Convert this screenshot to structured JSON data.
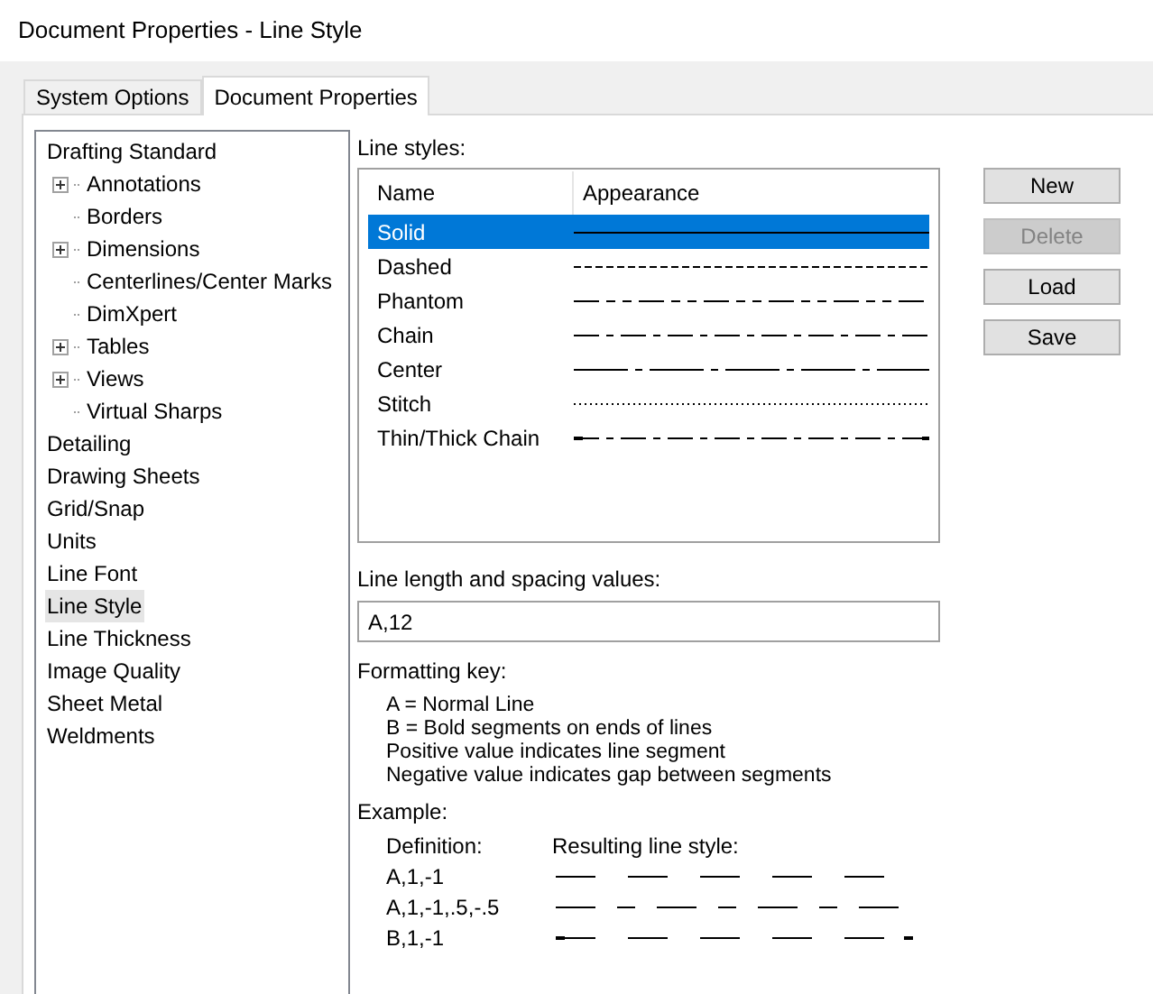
{
  "window": {
    "title": "Document Properties - Line Style"
  },
  "tabs": [
    {
      "label": "System Options",
      "selected": false
    },
    {
      "label": "Document Properties",
      "selected": true
    }
  ],
  "tree": [
    {
      "label": "Drafting Standard",
      "selected": false,
      "children": [
        {
          "label": "Annotations",
          "kind": "collapsed",
          "selected": false
        },
        {
          "label": "Borders",
          "kind": "leaf",
          "selected": false
        },
        {
          "label": "Dimensions",
          "kind": "collapsed",
          "selected": false
        },
        {
          "label": "Centerlines/Center Marks",
          "kind": "leaf",
          "selected": false
        },
        {
          "label": "DimXpert",
          "kind": "leaf",
          "selected": false
        },
        {
          "label": "Tables",
          "kind": "collapsed",
          "selected": false
        },
        {
          "label": "Views",
          "kind": "collapsed",
          "selected": false
        },
        {
          "label": "Virtual Sharps",
          "kind": "leaf",
          "selected": false
        }
      ]
    },
    {
      "label": "Detailing",
      "selected": false
    },
    {
      "label": "Drawing Sheets",
      "selected": false
    },
    {
      "label": "Grid/Snap",
      "selected": false
    },
    {
      "label": "Units",
      "selected": false
    },
    {
      "label": "Line Font",
      "selected": false
    },
    {
      "label": "Line Style",
      "selected": true
    },
    {
      "label": "Line Thickness",
      "selected": false
    },
    {
      "label": "Image Quality",
      "selected": false
    },
    {
      "label": "Sheet Metal",
      "selected": false
    },
    {
      "label": "Weldments",
      "selected": false
    }
  ],
  "line_styles": {
    "label": "Line styles:",
    "columns": [
      "Name",
      "Appearance"
    ],
    "rows": [
      {
        "name": "Solid",
        "kind": "solid",
        "selected": true
      },
      {
        "name": "Dashed",
        "kind": "dashed",
        "selected": false
      },
      {
        "name": "Phantom",
        "kind": "phantom",
        "selected": false
      },
      {
        "name": "Chain",
        "kind": "chain",
        "selected": false
      },
      {
        "name": "Center",
        "kind": "center",
        "selected": false
      },
      {
        "name": "Stitch",
        "kind": "stitch",
        "selected": false
      },
      {
        "name": "Thin/Thick Chain",
        "kind": "thin_thick_chain",
        "selected": false
      }
    ]
  },
  "buttons": [
    {
      "label": "New",
      "disabled": false
    },
    {
      "label": "Delete",
      "disabled": true
    },
    {
      "label": "Load",
      "disabled": false
    },
    {
      "label": "Save",
      "disabled": false
    }
  ],
  "spacing": {
    "label": "Line length and spacing values:",
    "value": "A,12"
  },
  "formatting_key": {
    "label": "Formatting key:",
    "lines": [
      "A = Normal Line",
      "B = Bold segments on ends of lines",
      "Positive value indicates line segment",
      "Negative value indicates gap between segments"
    ]
  },
  "example": {
    "label": "Example:",
    "definition_header": "Definition:",
    "result_header": "Resulting line style:",
    "rows": [
      {
        "definition": "A,1,-1",
        "kind": "dash_gap"
      },
      {
        "definition": "A,1,-1,.5,-.5",
        "kind": "dash_short"
      },
      {
        "definition": "B,1,-1",
        "kind": "bold_ends"
      }
    ]
  }
}
